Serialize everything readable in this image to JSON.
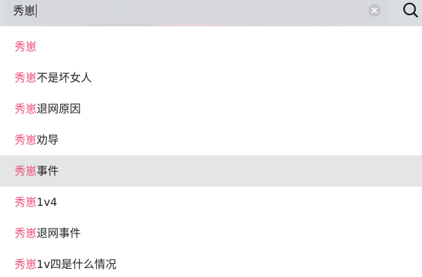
{
  "search": {
    "query": "秀崽"
  },
  "suggestions": {
    "active_index": 4,
    "highlight_color": "#ee4f78",
    "items": [
      {
        "match": "秀崽",
        "rest": ""
      },
      {
        "match": "秀崽",
        "rest": "不是坏女人"
      },
      {
        "match": "秀崽",
        "rest": "退网原因"
      },
      {
        "match": "秀崽",
        "rest": "劝导"
      },
      {
        "match": "秀崽",
        "rest": "事件"
      },
      {
        "match": "秀崽",
        "rest": "1v4"
      },
      {
        "match": "秀崽",
        "rest": "退网事件"
      },
      {
        "match": "秀崽",
        "rest": "1v四是什么情况"
      }
    ]
  },
  "icons": {
    "clear": "clear-circle-icon",
    "search": "search-icon"
  }
}
